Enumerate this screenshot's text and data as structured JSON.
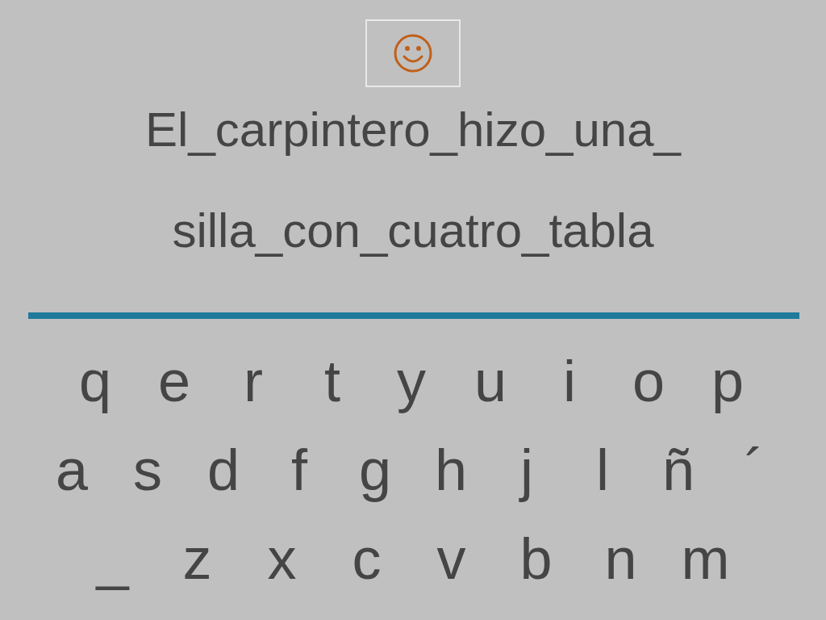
{
  "sentence_lines": [
    "El_carpintero_hizo_una_",
    "silla_con_cuatro_tabla"
  ],
  "keyboard_rows": [
    [
      "q",
      "e",
      "r",
      "t",
      "y",
      "u",
      "i",
      "o",
      "p"
    ],
    [
      "a",
      "s",
      "d",
      "f",
      "g",
      "h",
      "j",
      "l",
      "ñ",
      "´"
    ],
    [
      "_",
      "z",
      "x",
      "c",
      "v",
      "b",
      "n",
      "m"
    ]
  ]
}
